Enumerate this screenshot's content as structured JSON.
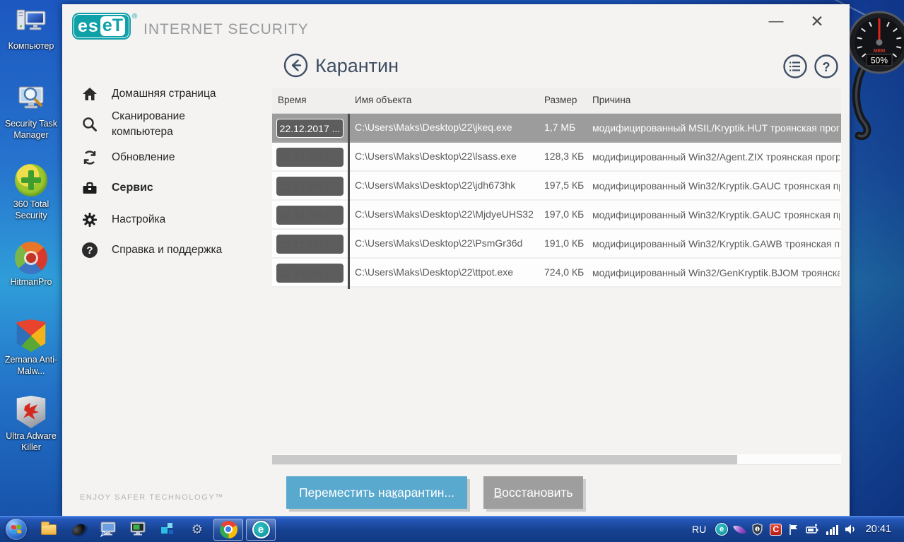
{
  "desktop": {
    "icons": [
      {
        "label": "Компьютер"
      },
      {
        "label": "Security Task Manager"
      },
      {
        "label": "360 Total Security"
      },
      {
        "label": "HitmanPro"
      },
      {
        "label": "Zemana Anti-Malw..."
      },
      {
        "label": "Ultra Adware Killer"
      }
    ],
    "gadget": {
      "label": "MEM",
      "value": "50%"
    }
  },
  "window": {
    "brand": {
      "logo_left": "es",
      "logo_right": "eT",
      "registered": "®",
      "product": "INTERNET SECURITY"
    },
    "controls": {
      "minimize": "—",
      "close": "✕"
    },
    "sidebar": {
      "items": [
        {
          "label": "Домашняя страница"
        },
        {
          "label": "Сканирование компьютера"
        },
        {
          "label": "Обновление"
        },
        {
          "label": "Сервис"
        },
        {
          "label": "Настройка"
        },
        {
          "label": "Справка и поддержка"
        }
      ],
      "tagline": "ENJOY SAFER TECHNOLOGY™"
    },
    "page": {
      "title": "Карантин",
      "table": {
        "headers": {
          "time": "Время",
          "name": "Имя объекта",
          "size": "Размер",
          "reason": "Причина"
        },
        "rows": [
          {
            "time": "22.12.2017 ...",
            "name": "C:\\Users\\Maks\\Desktop\\22\\jkeq.exe",
            "size": "1,7 МБ",
            "reason": "модифицированный MSIL/Kryptik.HUT троянская прогр"
          },
          {
            "time": "22.12.2017 ...",
            "name": "C:\\Users\\Maks\\Desktop\\22\\lsass.exe",
            "size": "128,3 КБ",
            "reason": "модифицированный Win32/Agent.ZIX троянская прогр"
          },
          {
            "time": "22.12.2017 ...",
            "name": "C:\\Users\\Maks\\Desktop\\22\\jdh673hk",
            "size": "197,5 КБ",
            "reason": "модифицированный Win32/Kryptik.GAUC троянская пр"
          },
          {
            "time": "22.12.2017 ...",
            "name": "C:\\Users\\Maks\\Desktop\\22\\MjdyeUHS32",
            "size": "197,0 КБ",
            "reason": "модифицированный Win32/Kryptik.GAUC троянская пр"
          },
          {
            "time": "22.12.2017 ...",
            "name": "C:\\Users\\Maks\\Desktop\\22\\PsmGr36d",
            "size": "191,0 КБ",
            "reason": "модифицированный Win32/Kryptik.GAWB троянская пр"
          },
          {
            "time": "22.12.2017 ...",
            "name": "C:\\Users\\Maks\\Desktop\\22\\ttpot.exe",
            "size": "724,0 КБ",
            "reason": "модифицированный Win32/GenKryptik.BJOM троянска"
          }
        ]
      },
      "buttons": {
        "quarantine": {
          "pre": "Переместить на ",
          "key": "к",
          "post": "арантин..."
        },
        "restore": {
          "pre": "",
          "key": "В",
          "post": "осстановить"
        }
      }
    }
  },
  "taskbar": {
    "language": "RU",
    "clock": "20:41"
  },
  "icons": {
    "help_glyph": "?",
    "eset_letter": "e",
    "comodo_letter": "C",
    "gear_glyph": "⚙"
  }
}
